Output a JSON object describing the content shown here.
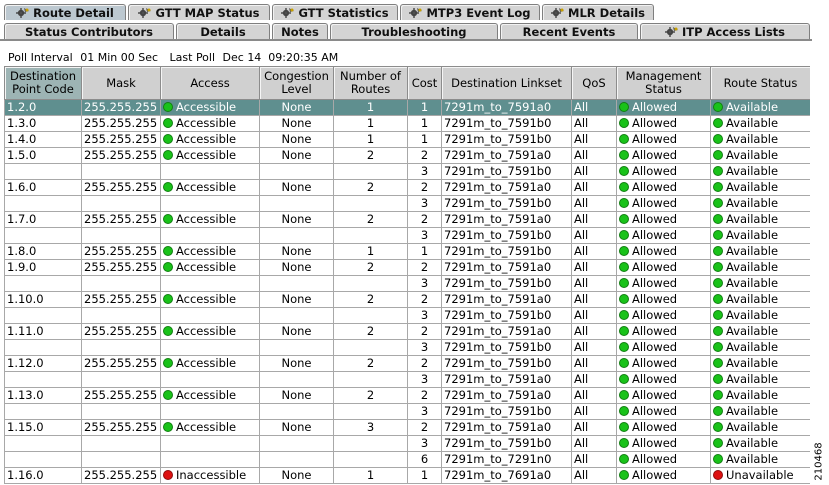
{
  "tabs_row1": [
    {
      "label": "Route Detail",
      "icon": "gear-icon",
      "active": true
    },
    {
      "label": "GTT MAP Status",
      "icon": "gear-icon",
      "active": false
    },
    {
      "label": "GTT Statistics",
      "icon": "gear-icon",
      "active": false
    },
    {
      "label": "MTP3 Event Log",
      "icon": "gear-icon",
      "active": false
    },
    {
      "label": "MLR Details",
      "icon": "gear-icon",
      "active": false
    }
  ],
  "tabs_row2": [
    {
      "label": "Status Contributors",
      "icon": ""
    },
    {
      "label": "Details",
      "icon": ""
    },
    {
      "label": "Notes",
      "icon": ""
    },
    {
      "label": "Troubleshooting",
      "icon": ""
    },
    {
      "label": "Recent Events",
      "icon": ""
    },
    {
      "label": "ITP Access Lists",
      "icon": "gear-icon"
    }
  ],
  "poll": {
    "interval_label": "Poll Interval",
    "interval_value": "01 Min 00 Sec",
    "last_label": "Last Poll",
    "last_value": "Dec 14  09:20:35 AM"
  },
  "columns": [
    "Destination Point Code",
    "Mask",
    "Access",
    "Congestion Level",
    "Number of Routes",
    "Cost",
    "Destination Linkset",
    "QoS",
    "Management Status",
    "Route Status"
  ],
  "status_colors": {
    "green": "#19c219",
    "red": "#dd1111",
    "highlight": "#5f8f8f"
  },
  "rows": [
    {
      "dpc": "1.2.0",
      "mask": "255.255.255",
      "access": "Accessible",
      "access_status": "green",
      "cong": "None",
      "routes": "1",
      "cost": "1",
      "linkset": "7291m_to_7591a0",
      "qos": "All",
      "mgmt": "Allowed",
      "mgmt_status": "green",
      "route": "Available",
      "route_status": "green",
      "selected": true
    },
    {
      "dpc": "1.3.0",
      "mask": "255.255.255",
      "access": "Accessible",
      "access_status": "green",
      "cong": "None",
      "routes": "1",
      "cost": "1",
      "linkset": "7291m_to_7591b0",
      "qos": "All",
      "mgmt": "Allowed",
      "mgmt_status": "green",
      "route": "Available",
      "route_status": "green"
    },
    {
      "dpc": "1.4.0",
      "mask": "255.255.255",
      "access": "Accessible",
      "access_status": "green",
      "cong": "None",
      "routes": "1",
      "cost": "1",
      "linkset": "7291m_to_7591b0",
      "qos": "All",
      "mgmt": "Allowed",
      "mgmt_status": "green",
      "route": "Available",
      "route_status": "green"
    },
    {
      "dpc": "1.5.0",
      "mask": "255.255.255",
      "access": "Accessible",
      "access_status": "green",
      "cong": "None",
      "routes": "2",
      "cost": "2",
      "linkset": "7291m_to_7591a0",
      "qos": "All",
      "mgmt": "Allowed",
      "mgmt_status": "green",
      "route": "Available",
      "route_status": "green"
    },
    {
      "dpc": "",
      "mask": "",
      "access": "",
      "access_status": "",
      "cong": "",
      "routes": "",
      "cost": "3",
      "linkset": "7291m_to_7591b0",
      "qos": "All",
      "mgmt": "Allowed",
      "mgmt_status": "green",
      "route": "Available",
      "route_status": "green"
    },
    {
      "dpc": "1.6.0",
      "mask": "255.255.255",
      "access": "Accessible",
      "access_status": "green",
      "cong": "None",
      "routes": "2",
      "cost": "2",
      "linkset": "7291m_to_7591a0",
      "qos": "All",
      "mgmt": "Allowed",
      "mgmt_status": "green",
      "route": "Available",
      "route_status": "green"
    },
    {
      "dpc": "",
      "mask": "",
      "access": "",
      "access_status": "",
      "cong": "",
      "routes": "",
      "cost": "3",
      "linkset": "7291m_to_7591b0",
      "qos": "All",
      "mgmt": "Allowed",
      "mgmt_status": "green",
      "route": "Available",
      "route_status": "green"
    },
    {
      "dpc": "1.7.0",
      "mask": "255.255.255",
      "access": "Accessible",
      "access_status": "green",
      "cong": "None",
      "routes": "2",
      "cost": "2",
      "linkset": "7291m_to_7591a0",
      "qos": "All",
      "mgmt": "Allowed",
      "mgmt_status": "green",
      "route": "Available",
      "route_status": "green"
    },
    {
      "dpc": "",
      "mask": "",
      "access": "",
      "access_status": "",
      "cong": "",
      "routes": "",
      "cost": "3",
      "linkset": "7291m_to_7591b0",
      "qos": "All",
      "mgmt": "Allowed",
      "mgmt_status": "green",
      "route": "Available",
      "route_status": "green"
    },
    {
      "dpc": "1.8.0",
      "mask": "255.255.255",
      "access": "Accessible",
      "access_status": "green",
      "cong": "None",
      "routes": "1",
      "cost": "1",
      "linkset": "7291m_to_7591b0",
      "qos": "All",
      "mgmt": "Allowed",
      "mgmt_status": "green",
      "route": "Available",
      "route_status": "green"
    },
    {
      "dpc": "1.9.0",
      "mask": "255.255.255",
      "access": "Accessible",
      "access_status": "green",
      "cong": "None",
      "routes": "2",
      "cost": "2",
      "linkset": "7291m_to_7591a0",
      "qos": "All",
      "mgmt": "Allowed",
      "mgmt_status": "green",
      "route": "Available",
      "route_status": "green"
    },
    {
      "dpc": "",
      "mask": "",
      "access": "",
      "access_status": "",
      "cong": "",
      "routes": "",
      "cost": "3",
      "linkset": "7291m_to_7591b0",
      "qos": "All",
      "mgmt": "Allowed",
      "mgmt_status": "green",
      "route": "Available",
      "route_status": "green"
    },
    {
      "dpc": "1.10.0",
      "mask": "255.255.255",
      "access": "Accessible",
      "access_status": "green",
      "cong": "None",
      "routes": "2",
      "cost": "2",
      "linkset": "7291m_to_7591a0",
      "qos": "All",
      "mgmt": "Allowed",
      "mgmt_status": "green",
      "route": "Available",
      "route_status": "green"
    },
    {
      "dpc": "",
      "mask": "",
      "access": "",
      "access_status": "",
      "cong": "",
      "routes": "",
      "cost": "3",
      "linkset": "7291m_to_7591b0",
      "qos": "All",
      "mgmt": "Allowed",
      "mgmt_status": "green",
      "route": "Available",
      "route_status": "green"
    },
    {
      "dpc": "1.11.0",
      "mask": "255.255.255",
      "access": "Accessible",
      "access_status": "green",
      "cong": "None",
      "routes": "2",
      "cost": "2",
      "linkset": "7291m_to_7591a0",
      "qos": "All",
      "mgmt": "Allowed",
      "mgmt_status": "green",
      "route": "Available",
      "route_status": "green"
    },
    {
      "dpc": "",
      "mask": "",
      "access": "",
      "access_status": "",
      "cong": "",
      "routes": "",
      "cost": "3",
      "linkset": "7291m_to_7591b0",
      "qos": "All",
      "mgmt": "Allowed",
      "mgmt_status": "green",
      "route": "Available",
      "route_status": "green"
    },
    {
      "dpc": "1.12.0",
      "mask": "255.255.255",
      "access": "Accessible",
      "access_status": "green",
      "cong": "None",
      "routes": "2",
      "cost": "2",
      "linkset": "7291m_to_7591b0",
      "qos": "All",
      "mgmt": "Allowed",
      "mgmt_status": "green",
      "route": "Available",
      "route_status": "green"
    },
    {
      "dpc": "",
      "mask": "",
      "access": "",
      "access_status": "",
      "cong": "",
      "routes": "",
      "cost": "3",
      "linkset": "7291m_to_7591a0",
      "qos": "All",
      "mgmt": "Allowed",
      "mgmt_status": "green",
      "route": "Available",
      "route_status": "green"
    },
    {
      "dpc": "1.13.0",
      "mask": "255.255.255",
      "access": "Accessible",
      "access_status": "green",
      "cong": "None",
      "routes": "2",
      "cost": "2",
      "linkset": "7291m_to_7591a0",
      "qos": "All",
      "mgmt": "Allowed",
      "mgmt_status": "green",
      "route": "Available",
      "route_status": "green"
    },
    {
      "dpc": "",
      "mask": "",
      "access": "",
      "access_status": "",
      "cong": "",
      "routes": "",
      "cost": "3",
      "linkset": "7291m_to_7591b0",
      "qos": "All",
      "mgmt": "Allowed",
      "mgmt_status": "green",
      "route": "Available",
      "route_status": "green"
    },
    {
      "dpc": "1.15.0",
      "mask": "255.255.255",
      "access": "Accessible",
      "access_status": "green",
      "cong": "None",
      "routes": "3",
      "cost": "2",
      "linkset": "7291m_to_7591a0",
      "qos": "All",
      "mgmt": "Allowed",
      "mgmt_status": "green",
      "route": "Available",
      "route_status": "green"
    },
    {
      "dpc": "",
      "mask": "",
      "access": "",
      "access_status": "",
      "cong": "",
      "routes": "",
      "cost": "3",
      "linkset": "7291m_to_7591b0",
      "qos": "All",
      "mgmt": "Allowed",
      "mgmt_status": "green",
      "route": "Available",
      "route_status": "green"
    },
    {
      "dpc": "",
      "mask": "",
      "access": "",
      "access_status": "",
      "cong": "",
      "routes": "",
      "cost": "6",
      "linkset": "7291m_to_7291n0",
      "qos": "All",
      "mgmt": "Allowed",
      "mgmt_status": "green",
      "route": "Available",
      "route_status": "green"
    },
    {
      "dpc": "1.16.0",
      "mask": "255.255.255",
      "access": "Inaccessible",
      "access_status": "red",
      "cong": "None",
      "routes": "1",
      "cost": "1",
      "linkset": "7291m_to_7691a0",
      "qos": "All",
      "mgmt": "Allowed",
      "mgmt_status": "green",
      "route": "Unavailable",
      "route_status": "red"
    }
  ],
  "figure_code": "210468"
}
